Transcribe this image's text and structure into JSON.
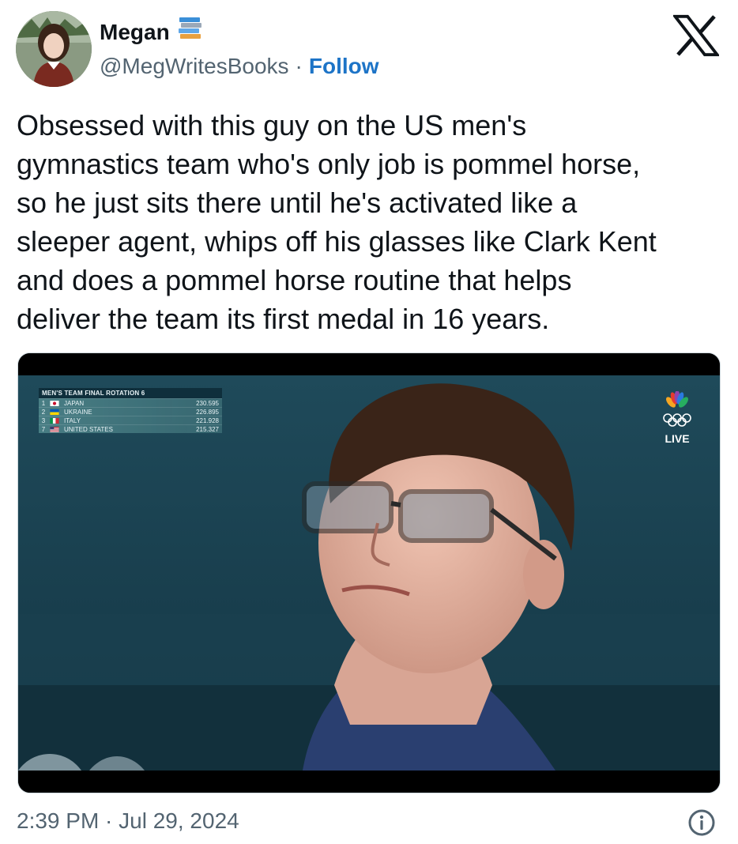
{
  "author": {
    "display_name": "Megan",
    "badge_icon": "books-emoji-icon",
    "handle": "@MegWritesBooks",
    "separator": "·",
    "follow_label": "Follow"
  },
  "platform_icon": "x-logo-icon",
  "tweet": {
    "text": "Obsessed with this guy on the US men's\ngymnastics team who's only job is pommel horse,\nso he just sits there until he's activated like a\nsleeper agent, whips off his glasses like Clark Kent\nand does a pommel horse routine that helps\ndeliver the team its first medal in 16 years."
  },
  "media": {
    "scoreboard": {
      "title": "MEN'S TEAM FINAL  ROTATION 6",
      "rows": [
        {
          "rank": "1",
          "country": "JAPAN",
          "score": "230.595"
        },
        {
          "rank": "2",
          "country": "UKRAINE",
          "score": "226.895"
        },
        {
          "rank": "3",
          "country": "ITALY",
          "score": "221.928"
        },
        {
          "rank": "7",
          "country": "UNITED STATES",
          "score": "215.327"
        }
      ]
    },
    "broadcast": {
      "network_icon": "nbc-peacock-icon",
      "olympic_icon": "olympic-rings-icon",
      "live_label": "LIVE"
    }
  },
  "footer": {
    "timestamp": "2:39 PM · Jul 29, 2024",
    "info_icon": "info-icon"
  },
  "colors": {
    "follow": "#1d74c7",
    "secondary_text": "#536471",
    "text": "#0f1419"
  }
}
